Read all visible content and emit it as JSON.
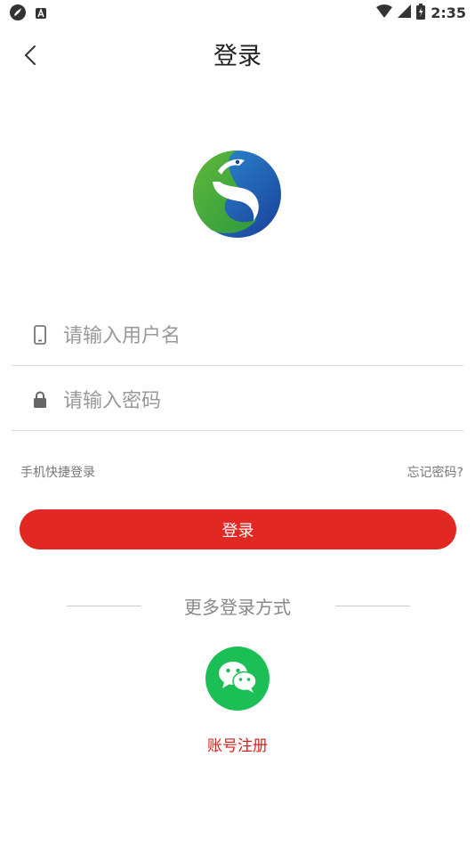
{
  "status_bar": {
    "time": "2:35"
  },
  "header": {
    "title": "登录",
    "back_icon": "chevron-left-icon"
  },
  "form": {
    "username_placeholder": "请输入用户名",
    "username_value": "",
    "password_placeholder": "请输入密码",
    "password_value": "",
    "quick_login_label": "手机快捷登录",
    "forgot_password_label": "忘记密码?",
    "login_button_label": "登录"
  },
  "alt_login": {
    "title": "更多登录方式",
    "wechat_icon": "wechat-icon"
  },
  "register": {
    "label": "账号注册"
  },
  "colors": {
    "accent_red": "#e12822",
    "register_red": "#d3211b",
    "wechat_green": "#1bbf55",
    "logo_blue": "#1e5fb0",
    "logo_green": "#3aa63a"
  }
}
